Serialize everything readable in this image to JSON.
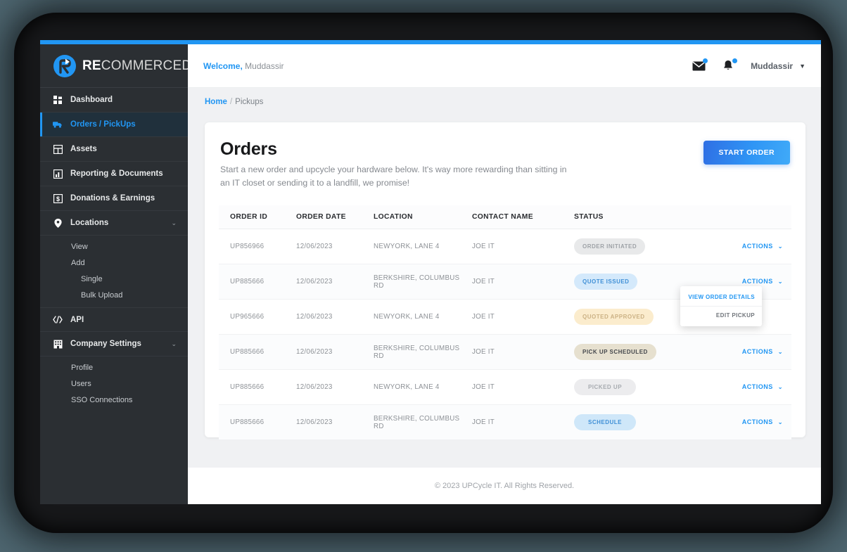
{
  "brand": {
    "logo_text_bold": "RE",
    "logo_text_rest": "COMMERCED",
    "logo_icon": "recycle-r-logo"
  },
  "sidebar": {
    "items": [
      {
        "label": "Dashboard",
        "icon": "dashboard-grid-icon",
        "active": false,
        "caret": ""
      },
      {
        "label": "Orders / PickUps",
        "icon": "truck-icon",
        "active": true,
        "caret": ""
      },
      {
        "label": "Assets",
        "icon": "assets-grid-icon",
        "active": false,
        "caret": ""
      },
      {
        "label": "Reporting & Documents",
        "icon": "bar-chart-icon",
        "active": false,
        "caret": ""
      },
      {
        "label": "Donations & Earnings",
        "icon": "dollar-square-icon",
        "active": false,
        "caret": ""
      },
      {
        "label": "Locations",
        "icon": "map-pin-icon",
        "active": false,
        "caret": "⌄"
      },
      {
        "label": "API",
        "icon": "code-icon",
        "active": false,
        "caret": ""
      },
      {
        "label": "Company Settings",
        "icon": "building-icon",
        "active": false,
        "caret": "⌄"
      }
    ],
    "locations_sub": [
      {
        "label": "View",
        "deep": false
      },
      {
        "label": "Add",
        "deep": false
      },
      {
        "label": "Single",
        "deep": true
      },
      {
        "label": "Bulk Upload",
        "deep": true
      }
    ],
    "company_sub": [
      {
        "label": "Profile",
        "deep": false
      },
      {
        "label": "Users",
        "deep": false
      },
      {
        "label": "SSO Connections",
        "deep": false
      }
    ]
  },
  "topbar": {
    "welcome_label": "Welcome,",
    "welcome_user": " Muddassir",
    "mail_icon": "envelope-icon",
    "bell_icon": "bell-icon",
    "user_name": "Muddassir",
    "user_caret": "▼"
  },
  "breadcrumb": {
    "home": "Home",
    "separator": "/",
    "current": "Pickups"
  },
  "page": {
    "title": "Orders",
    "subtitle": "Start a new order and upcycle your hardware below. It's way more rewarding than sitting in an IT closet or sending it to a landfill, we promise!",
    "start_order_button": "START ORDER"
  },
  "table": {
    "columns": [
      "ORDER ID",
      "ORDER DATE",
      "LOCATION",
      "CONTACT NAME",
      "STATUS",
      ""
    ],
    "actions_label": "ACTIONS",
    "actions_caret": "⌄",
    "rows": [
      {
        "id": "UP856966",
        "date": "12/06/2023",
        "location": "NEWYORK, LANE 4",
        "contact": "JOE IT",
        "status": "ORDER INITIATED",
        "status_bg": "#e8e9ea",
        "status_fg": "#9ea2a7"
      },
      {
        "id": "UP885666",
        "date": "12/06/2023",
        "location": "BERKSHIRE, COLUMBUS RD",
        "contact": "JOE IT",
        "status": "QUOTE ISSUED",
        "status_bg": "#d4e9fb",
        "status_fg": "#3f8fd6"
      },
      {
        "id": "UP965666",
        "date": "12/06/2023",
        "location": "NEWYORK, LANE 4",
        "contact": "JOE IT",
        "status": "QUOTED APPROVED",
        "status_bg": "#fbeccd",
        "status_fg": "#cbb184"
      },
      {
        "id": "UP885666",
        "date": "12/06/2023",
        "location": "BERKSHIRE, COLUMBUS RD",
        "contact": "JOE IT",
        "status": "PICK UP SCHEDULED",
        "status_bg": "#e6e0cf",
        "status_fg": "#45484d"
      },
      {
        "id": "UP885666",
        "date": "12/06/2023",
        "location": "NEWYORK, LANE 4",
        "contact": "JOE IT",
        "status": "PICKED UP",
        "status_bg": "#ececee",
        "status_fg": "#a7abb0"
      },
      {
        "id": "UP885666",
        "date": "12/06/2023",
        "location": "BERKSHIRE, COLUMBUS RD",
        "contact": "JOE IT",
        "status": "SCHEDULE",
        "status_bg": "#cfe7f9",
        "status_fg": "#3f8fd6"
      }
    ]
  },
  "dropdown": {
    "open_on_row": 1,
    "view_order_details": "VIEW ORDER DETAILS",
    "edit_pickup": "EDIT PICKUP"
  },
  "footer": {
    "text": "© 2023 UPCycle IT. All Rights Reserved."
  },
  "colors": {
    "accent": "#2196f3",
    "sidebar_bg": "#2b2f33",
    "page_bg": "#f0f1f3",
    "frame": "#17181a",
    "desktop": "#4e6670"
  }
}
